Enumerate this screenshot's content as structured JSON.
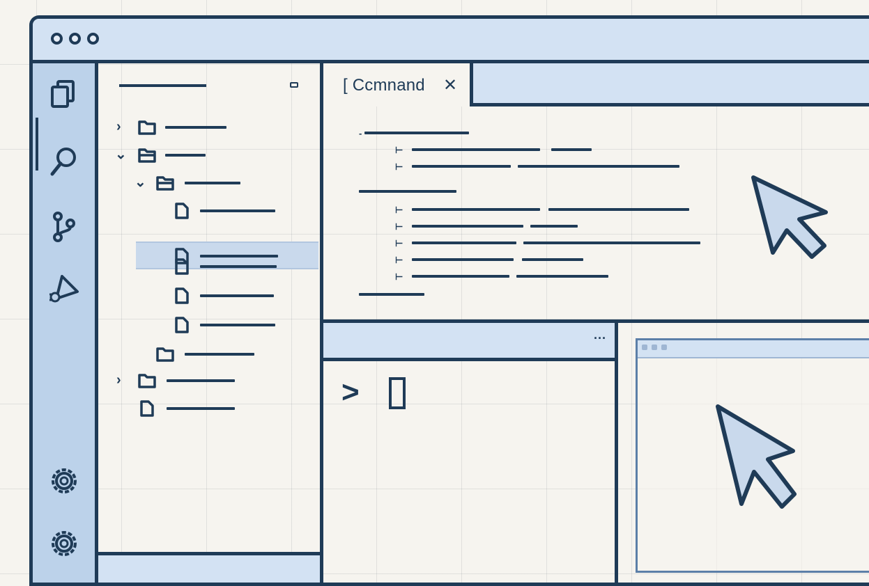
{
  "editor": {
    "active_tab_label": "[ Ccmnand",
    "close_glyph": "✕",
    "more_glyph": "···"
  },
  "terminal": {
    "prompt_glyph": ">",
    "more_glyph": "···"
  },
  "icons": {
    "activity_bar": [
      "files-icon",
      "search-icon",
      "source-control-icon",
      "run-debug-icon",
      "settings-icon",
      "settings-icon"
    ],
    "tree": [
      "folder-icon",
      "folder-open-icon",
      "file-icon"
    ]
  },
  "colors": {
    "ink": "#1f3b57",
    "panel": "#d3e2f3",
    "activity": "#bcd2ea",
    "background": "#f6f4ef",
    "selection": "#c9d9ec"
  }
}
